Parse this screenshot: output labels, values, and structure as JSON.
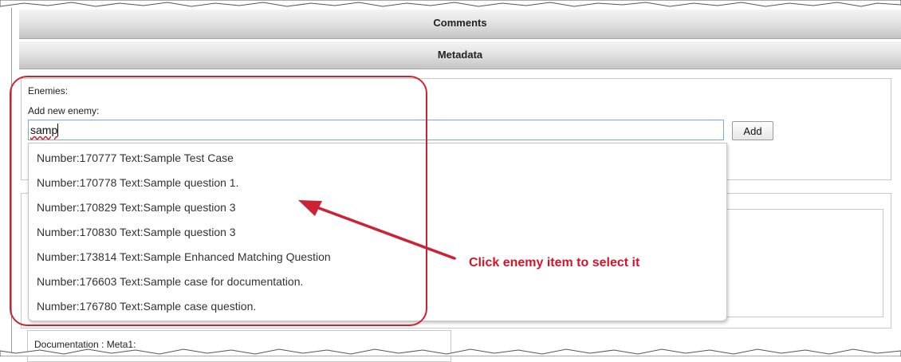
{
  "sections": {
    "comments_label": "Comments",
    "metadata_label": "Metadata"
  },
  "enemies": {
    "heading": "Enemies:",
    "add_label": "Add new enemy:",
    "input_value": "samp",
    "add_button_label": "Add",
    "suggestions": [
      "Number:170777 Text:Sample Test Case",
      "Number:170778 Text:Sample question 1.",
      "Number:170829 Text:Sample question 3",
      "Number:170830 Text:Sample question 3",
      "Number:173814 Text:Sample Enhanced Matching Question",
      "Number:176603 Text:Sample case for documentation.",
      "Number:176780 Text:Sample case question."
    ]
  },
  "documentation": {
    "label": "Documentation : Meta1:"
  },
  "annotation": {
    "callout_text": "Click enemy item to select it",
    "color": "#d3142a"
  }
}
